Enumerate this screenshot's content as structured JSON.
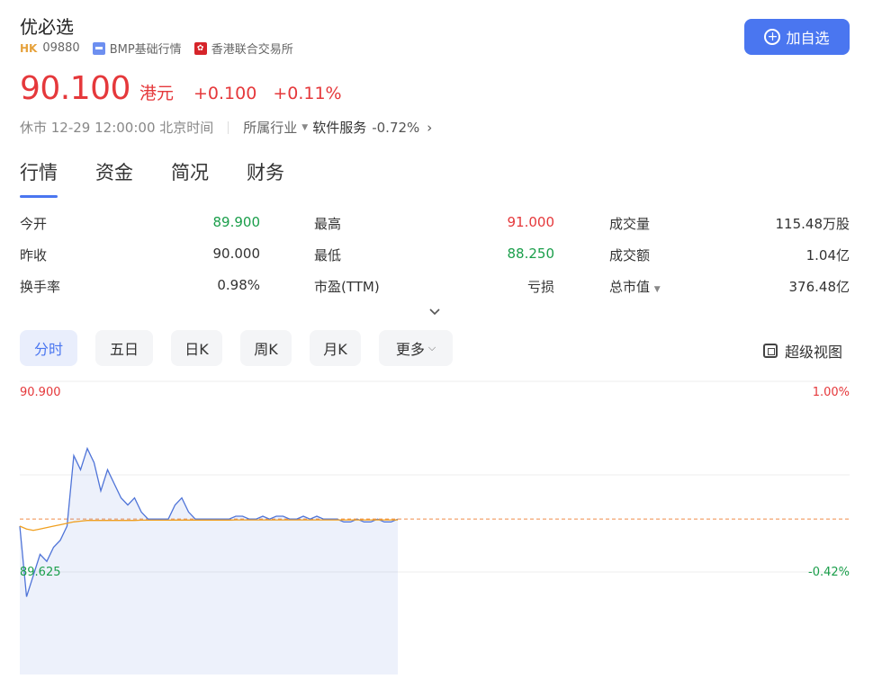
{
  "header": {
    "title": "优必选",
    "market_tag": "HK",
    "code": "09880",
    "data_source": "BMP基础行情",
    "exchange": "香港联合交易所",
    "add_button_label": "加自选"
  },
  "quote": {
    "price": "90.100",
    "currency": "港元",
    "change": "+0.100",
    "change_pct": "+0.11%"
  },
  "status": {
    "text": "休市 12-29 12:00:00 北京时间",
    "industry_label": "所属行业",
    "industry_name": "软件服务",
    "industry_pct": "-0.72%"
  },
  "tabs": [
    "行情",
    "资金",
    "简况",
    "财务"
  ],
  "stats": [
    {
      "label": "今开",
      "value": "89.900",
      "color": "green"
    },
    {
      "label": "最高",
      "value": "91.000",
      "color": "red"
    },
    {
      "label": "成交量",
      "value": "115.48万股",
      "color": ""
    },
    {
      "label": "昨收",
      "value": "90.000",
      "color": ""
    },
    {
      "label": "最低",
      "value": "88.250",
      "color": "green"
    },
    {
      "label": "成交额",
      "value": "1.04亿",
      "color": ""
    },
    {
      "label": "换手率",
      "value": "0.98%",
      "color": ""
    },
    {
      "label": "市盈(TTM)",
      "value": "亏损",
      "color": ""
    },
    {
      "label": "总市值",
      "value": "376.48亿",
      "color": ""
    }
  ],
  "periods": [
    "分时",
    "五日",
    "日K",
    "周K",
    "月K",
    "更多"
  ],
  "super_view_label": "超级视图",
  "colors": {
    "up": "#e5383b",
    "down": "#1a9e4a",
    "accent": "#4a76f0",
    "price_line": "#4f74d8",
    "avg_line": "#f0a020",
    "ref_line": "#f08c4a"
  },
  "chart_data": {
    "type": "line",
    "y_top_label": "90.900",
    "y_bottom_label": "89.625",
    "pct_top_label": "1.00%",
    "pct_bottom_label": "-0.42%",
    "ylim": [
      89.625,
      90.9
    ],
    "prev_close": 90.0,
    "series": [
      {
        "values": [
          89.95,
          89.45,
          89.6,
          89.75,
          89.7,
          89.8,
          89.85,
          89.95,
          90.45,
          90.35,
          90.5,
          90.4,
          90.2,
          90.35,
          90.25,
          90.15,
          90.1,
          90.15,
          90.05,
          90.0,
          90.0,
          90.0,
          90.0,
          90.1,
          90.15,
          90.05,
          90.0,
          90.0,
          90.0,
          90.0,
          90.0,
          90.0,
          90.02,
          90.02,
          90.0,
          90.0,
          90.02,
          90.0,
          90.02,
          90.02,
          90.0,
          90.0,
          90.02,
          90.0,
          90.02,
          90.0,
          90.0,
          90.0,
          89.98,
          89.98,
          90.0,
          89.98,
          89.98,
          90.0,
          89.98,
          89.98,
          90.0
        ]
      },
      {
        "values": [
          89.95,
          89.93,
          89.92,
          89.93,
          89.94,
          89.95,
          89.96,
          89.97,
          89.98,
          89.985,
          89.99,
          89.99,
          89.99,
          89.99,
          89.99,
          89.99,
          89.99,
          89.99,
          89.992,
          89.992,
          89.992,
          89.992,
          89.992,
          89.993,
          89.993,
          89.993,
          89.993,
          89.993,
          89.993,
          89.993,
          89.993,
          89.993,
          89.994,
          89.994,
          89.994,
          89.994,
          89.994,
          89.994,
          89.994,
          89.994,
          89.994,
          89.994,
          89.994,
          89.994,
          89.994,
          89.994,
          89.994,
          89.994,
          89.994,
          89.994,
          89.994,
          89.994,
          89.994,
          89.994,
          89.994,
          89.994,
          89.994
        ]
      }
    ]
  }
}
